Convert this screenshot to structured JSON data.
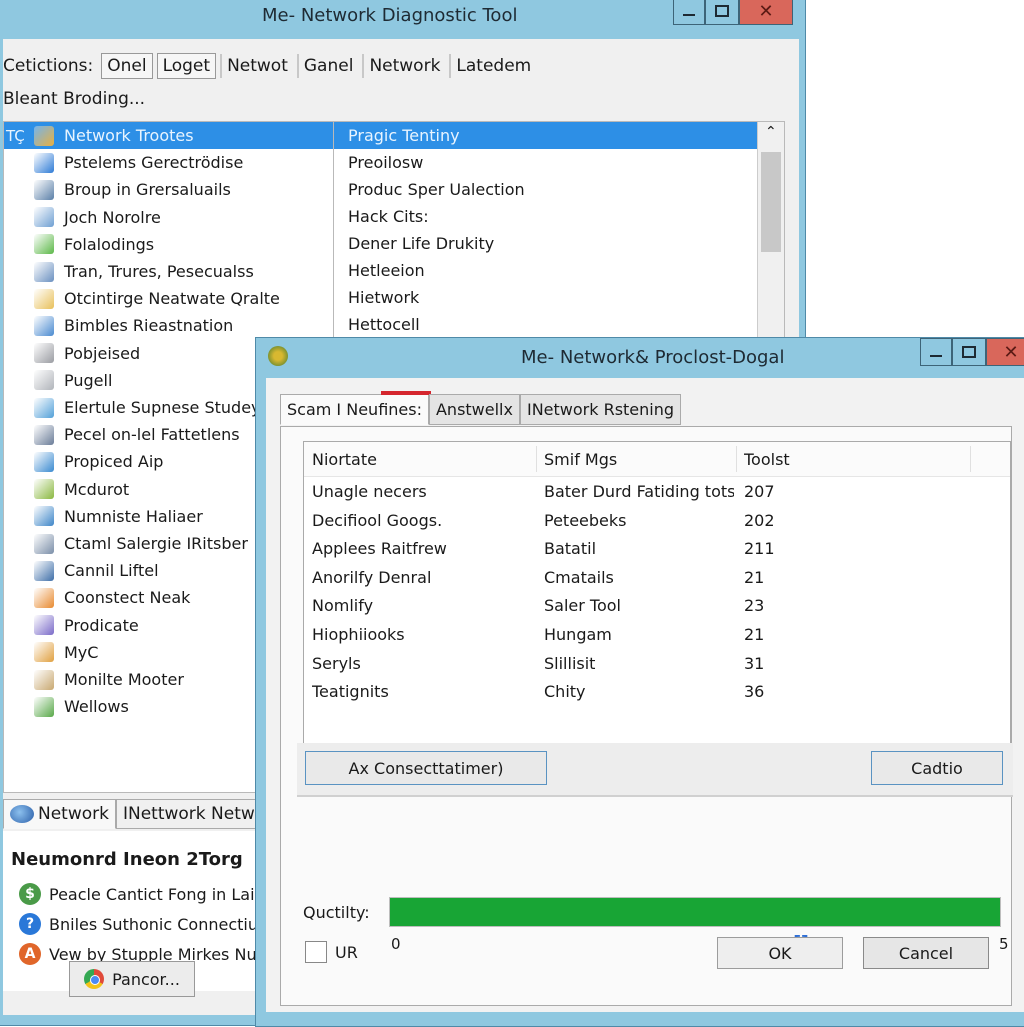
{
  "main_window": {
    "title": "Me- Network Diagnostic Tool",
    "toolbar": {
      "label": "Cetictions:",
      "buttons": [
        "Onel",
        "Loget",
        "Netwot",
        "Ganel",
        "Network",
        "Latedem"
      ]
    },
    "sub_label": "Bleant Broding...",
    "tree": {
      "selected_prefix": "TÇ",
      "items": [
        {
          "label": "Network Trootes",
          "icon": "folder-network-icon",
          "color": "#e8b040",
          "selected": true
        },
        {
          "label": "Pstelems Gerectrödise",
          "icon": "arrow-up-icon",
          "color": "#2e7bd6"
        },
        {
          "label": "Broup in Grersaluails",
          "icon": "monitor-icon",
          "color": "#5a7fa8"
        },
        {
          "label": "Joch Norolre",
          "icon": "network-computer-icon",
          "color": "#6e9fd2"
        },
        {
          "label": "Folalodings",
          "icon": "drive-icon",
          "color": "#5cb848"
        },
        {
          "label": "Tran, Trures, Pesecualss",
          "icon": "window-icon",
          "color": "#6a90c0"
        },
        {
          "label": "Otcintirge Neatwate Qralte",
          "icon": "folder-icon",
          "color": "#e8c05a"
        },
        {
          "label": "Bimbles Rieastnation",
          "icon": "server-icon",
          "color": "#4a8ad0"
        },
        {
          "label": "Pobjeised",
          "icon": "box-icon",
          "color": "#9a9ca2"
        },
        {
          "label": "Pugell",
          "icon": "cube-icon",
          "color": "#b0b4ba"
        },
        {
          "label": "Elertule Supnese Studey",
          "icon": "document-icon",
          "color": "#52a0d8"
        },
        {
          "label": "Pecel on-lel Fattetlens",
          "icon": "printer-icon",
          "color": "#6a7c98"
        },
        {
          "label": "Propiced Aip",
          "icon": "globe-icon",
          "color": "#3a8ad0"
        },
        {
          "label": "Mcdurot",
          "icon": "network-card-icon",
          "color": "#8ab840"
        },
        {
          "label": "Numniste Haliaer",
          "icon": "home-network-icon",
          "color": "#3e86c8"
        },
        {
          "label": "Ctaml Salergie IRitsber",
          "icon": "computer-icon",
          "color": "#7a8ea8"
        },
        {
          "label": "Cannil Liftel",
          "icon": "server-rack-icon",
          "color": "#3e6ea8"
        },
        {
          "label": "Coonstect Neak",
          "icon": "globe-orange-icon",
          "color": "#e88a30"
        },
        {
          "label": "Prodicate",
          "icon": "plug-icon",
          "color": "#7a6ac8"
        },
        {
          "label": "MyC",
          "icon": "cloud-icon",
          "color": "#e0a040"
        },
        {
          "label": "Monilte Mooter",
          "icon": "user-icon",
          "color": "#c8a870"
        },
        {
          "label": "Wellows",
          "icon": "globe-green-icon",
          "color": "#58a848"
        }
      ]
    },
    "details": {
      "items": [
        {
          "label": "Pragic Tentiny",
          "selected": true
        },
        {
          "label": "Preoilosw"
        },
        {
          "label": "Produc Sper Ualection"
        },
        {
          "label": "Hack Cits:"
        },
        {
          "label": "Dener Life Drukity"
        },
        {
          "label": "Hetleeion"
        },
        {
          "label": "Hietwork"
        },
        {
          "label": "Hettocell"
        }
      ]
    },
    "bottom_tabs": [
      {
        "label": "Network",
        "active": true
      },
      {
        "label": "INettwork Netwo"
      }
    ],
    "info": {
      "title": "Neumonrd Ineon 2Torg",
      "items": [
        {
          "label": "Peacle Cantict Fong in Lai",
          "icon": "dollar-icon",
          "color": "#4a9a48",
          "glyph": "$"
        },
        {
          "label": "Bniles Suthonic Connectiu",
          "icon": "help-icon",
          "color": "#2a78d8",
          "glyph": "?"
        },
        {
          "label": "Vew by Stupple Mirkes Nu",
          "icon": "alert-icon",
          "color": "#e0662a",
          "glyph": "A"
        }
      ]
    },
    "pancor_button": "Pancor..."
  },
  "dialog": {
    "title": "Me- Network& Proclost-Dogal",
    "tabs": [
      {
        "label": "Scam I Neufines:",
        "active": true
      },
      {
        "label": "Anstwellx"
      },
      {
        "label": "INetwork Rstening"
      }
    ],
    "table": {
      "columns": [
        "Niortate",
        "Smif Mgs",
        "Toolst"
      ],
      "rows": [
        [
          "Unagle necers",
          "Bater Durd Fatiding tots",
          "207"
        ],
        [
          "Decifiool Googs.",
          "Peteebeks",
          "202"
        ],
        [
          "Applees Raitfrew",
          "Batatil",
          "211"
        ],
        [
          "Anorilfy Denral",
          "Cmatails",
          "21"
        ],
        [
          "Nomlify",
          "Saler Tool",
          "23"
        ],
        [
          "Hiophiiooks",
          "Hungam",
          "21"
        ],
        [
          "Seryls",
          "Slillisit",
          "31"
        ],
        [
          "Teatignits",
          "Chity",
          "36"
        ]
      ]
    },
    "action_button": "Ax Consecttatimer)",
    "secondary_button": "Cadtio",
    "quality": {
      "label": "Quctilty:",
      "progress_percent": 100,
      "min_label": "0",
      "max_label": "5",
      "slider_handle": "<[]>",
      "color": "#18a535"
    },
    "checkbox": {
      "label": "UR",
      "checked": false
    },
    "ok_button": "OK",
    "cancel_button": "Cancel"
  }
}
